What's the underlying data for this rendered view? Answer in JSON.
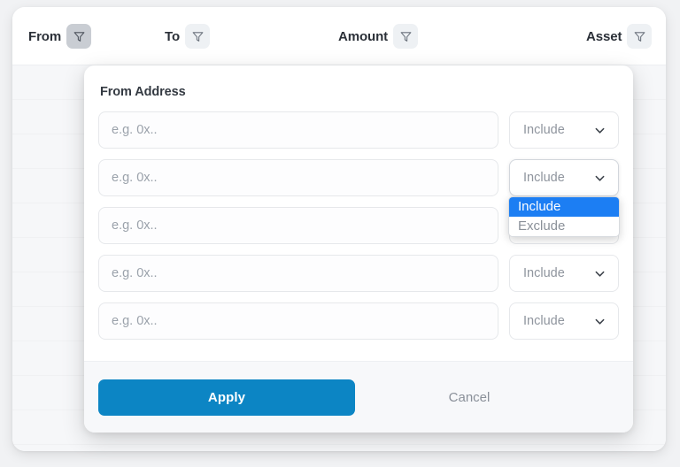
{
  "table": {
    "columns": [
      {
        "label": "From",
        "filter_icon": "funnel-icon",
        "active": true
      },
      {
        "label": "To",
        "filter_icon": "funnel-icon",
        "active": false
      },
      {
        "label": "Amount",
        "filter_icon": "funnel-icon",
        "active": false
      },
      {
        "label": "Asset",
        "filter_icon": "funnel-icon",
        "active": false
      }
    ]
  },
  "dialog": {
    "title": "From Address",
    "rows": [
      {
        "placeholder": "e.g. 0x..",
        "value": "",
        "mode": "Include"
      },
      {
        "placeholder": "e.g. 0x..",
        "value": "",
        "mode": "Include"
      },
      {
        "placeholder": "e.g. 0x..",
        "value": "",
        "mode": "Include"
      },
      {
        "placeholder": "e.g. 0x..",
        "value": "",
        "mode": "Include"
      },
      {
        "placeholder": "e.g. 0x..",
        "value": "",
        "mode": "Include"
      }
    ],
    "dropdown": {
      "open_row_index": 1,
      "options": [
        "Include",
        "Exclude"
      ],
      "selected": "Include"
    },
    "footer": {
      "apply_label": "Apply",
      "cancel_label": "Cancel"
    }
  },
  "colors": {
    "accent_blue": "#0c85c4",
    "highlight_blue": "#1c7ef3",
    "page_background": "#f1f2f4",
    "card_background": "#ffffff",
    "footer_background": "#f7f8fa",
    "muted_text": "#8f959e",
    "heading_text": "#2b3038"
  }
}
